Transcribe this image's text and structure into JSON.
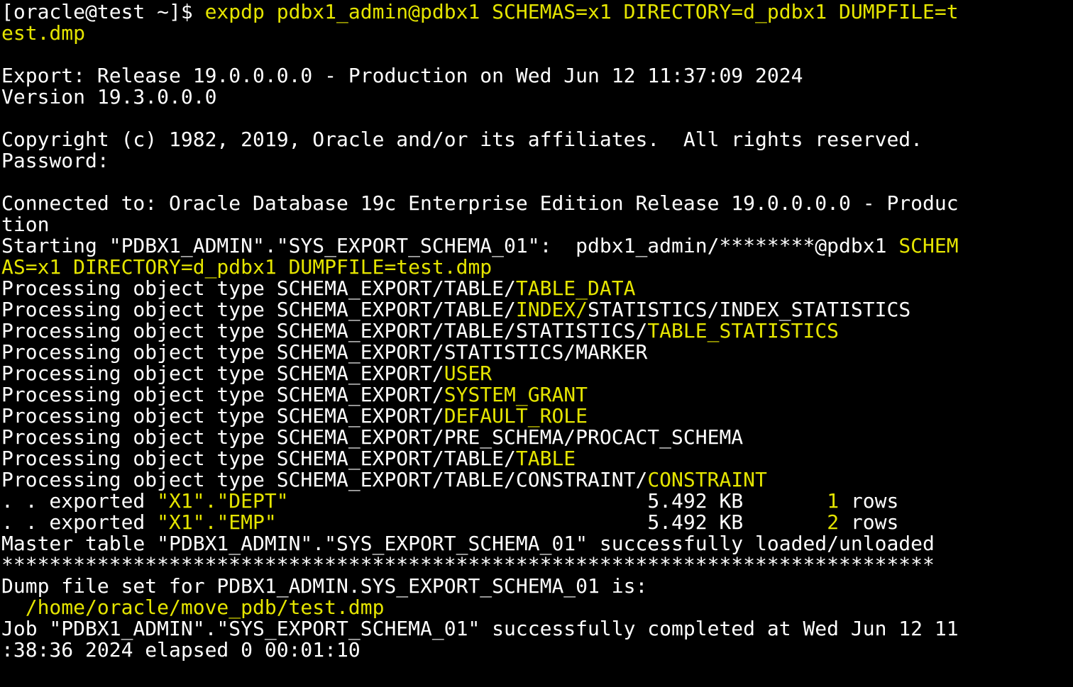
{
  "terminal": {
    "colors": {
      "background": "#000000",
      "text": "#ffffff",
      "highlight": "#e5e500"
    },
    "lines": [
      [
        {
          "t": "[oracle@test ~]$ ",
          "c": "w"
        },
        {
          "t": "expdp pdbx1_admin@pdbx1 SCHEMAS=x1 DIRECTORY=d_pdbx1 DUMPFILE=t",
          "c": "y"
        }
      ],
      [
        {
          "t": "est.dmp",
          "c": "y"
        }
      ],
      [],
      [
        {
          "t": "Export: Release 19.0.0.0.0 - Production on Wed Jun 12 11:37:09 2024",
          "c": "w"
        }
      ],
      [
        {
          "t": "Version 19.3.0.0.0",
          "c": "w"
        }
      ],
      [],
      [
        {
          "t": "Copyright (c) 1982, 2019, Oracle and/or its affiliates.  All rights reserved.",
          "c": "w"
        }
      ],
      [
        {
          "t": "Password:",
          "c": "w"
        }
      ],
      [],
      [
        {
          "t": "Connected to: Oracle Database 19c Enterprise Edition Release 19.0.0.0.0 - Produc",
          "c": "w"
        }
      ],
      [
        {
          "t": "tion",
          "c": "w"
        }
      ],
      [
        {
          "t": "Starting \"PDBX1_ADMIN\".\"SYS_EXPORT_SCHEMA_01\":  pdbx1_admin/********@pdbx1 ",
          "c": "w"
        },
        {
          "t": "SCHEM",
          "c": "y"
        }
      ],
      [
        {
          "t": "AS=x1 DIRECTORY=d_pdbx1 DUMPFILE=test.dmp",
          "c": "y"
        }
      ],
      [
        {
          "t": "Processing object type SCHEMA_EXPORT/TABLE/",
          "c": "w"
        },
        {
          "t": "TABLE_DATA",
          "c": "y"
        }
      ],
      [
        {
          "t": "Processing object type SCHEMA_EXPORT/TABLE/",
          "c": "w"
        },
        {
          "t": "INDEX/",
          "c": "y"
        },
        {
          "t": "STATISTICS/INDEX_STATISTICS",
          "c": "w"
        }
      ],
      [
        {
          "t": "Processing object type SCHEMA_EXPORT/TABLE/STATISTICS/",
          "c": "w"
        },
        {
          "t": "TABLE_STATISTICS",
          "c": "y"
        }
      ],
      [
        {
          "t": "Processing object type SCHEMA_EXPORT/STATISTICS/MARKER",
          "c": "w"
        }
      ],
      [
        {
          "t": "Processing object type SCHEMA_EXPORT/",
          "c": "w"
        },
        {
          "t": "USER",
          "c": "y"
        }
      ],
      [
        {
          "t": "Processing object type SCHEMA_EXPORT/",
          "c": "w"
        },
        {
          "t": "SYSTEM_GRANT",
          "c": "y"
        }
      ],
      [
        {
          "t": "Processing object type SCHEMA_EXPORT/",
          "c": "w"
        },
        {
          "t": "DEFAULT_ROLE",
          "c": "y"
        }
      ],
      [
        {
          "t": "Processing object type SCHEMA_EXPORT/PRE_SCHEMA/PROCACT_SCHEMA",
          "c": "w"
        }
      ],
      [
        {
          "t": "Processing object type SCHEMA_EXPORT/TABLE/",
          "c": "w"
        },
        {
          "t": "TABLE",
          "c": "y"
        }
      ],
      [
        {
          "t": "Processing object type SCHEMA_EXPORT/TABLE/CONSTRAINT/",
          "c": "w"
        },
        {
          "t": "CONSTRAINT",
          "c": "y"
        }
      ],
      [
        {
          "t": ". . exported ",
          "c": "w"
        },
        {
          "t": "\"X1\".\"DEPT\"",
          "c": "y"
        },
        {
          "t": "                              5.492 KB       ",
          "c": "w"
        },
        {
          "t": "1",
          "c": "y"
        },
        {
          "t": " rows",
          "c": "w"
        }
      ],
      [
        {
          "t": ". . exported ",
          "c": "w"
        },
        {
          "t": "\"X1\".\"EMP\"",
          "c": "y"
        },
        {
          "t": "                               5.492 KB       ",
          "c": "w"
        },
        {
          "t": "2",
          "c": "y"
        },
        {
          "t": " rows",
          "c": "w"
        }
      ],
      [
        {
          "t": "Master table \"PDBX1_ADMIN\".\"SYS_EXPORT_SCHEMA_01\" successfully loaded/unloaded",
          "c": "w"
        }
      ],
      [
        {
          "t": "******************************************************************************",
          "c": "w"
        }
      ],
      [
        {
          "t": "Dump file set for PDBX1_ADMIN.SYS_EXPORT_SCHEMA_01 is:",
          "c": "w"
        }
      ],
      [
        {
          "t": "  /home/oracle/move_pdb/test.dmp",
          "c": "y"
        }
      ],
      [
        {
          "t": "Job \"PDBX1_ADMIN\".\"SYS_EXPORT_SCHEMA_01\" successfully completed at Wed Jun 12 11",
          "c": "w"
        }
      ],
      [
        {
          "t": ":38:36 2024 elapsed 0 00:01:10",
          "c": "w"
        }
      ]
    ]
  }
}
